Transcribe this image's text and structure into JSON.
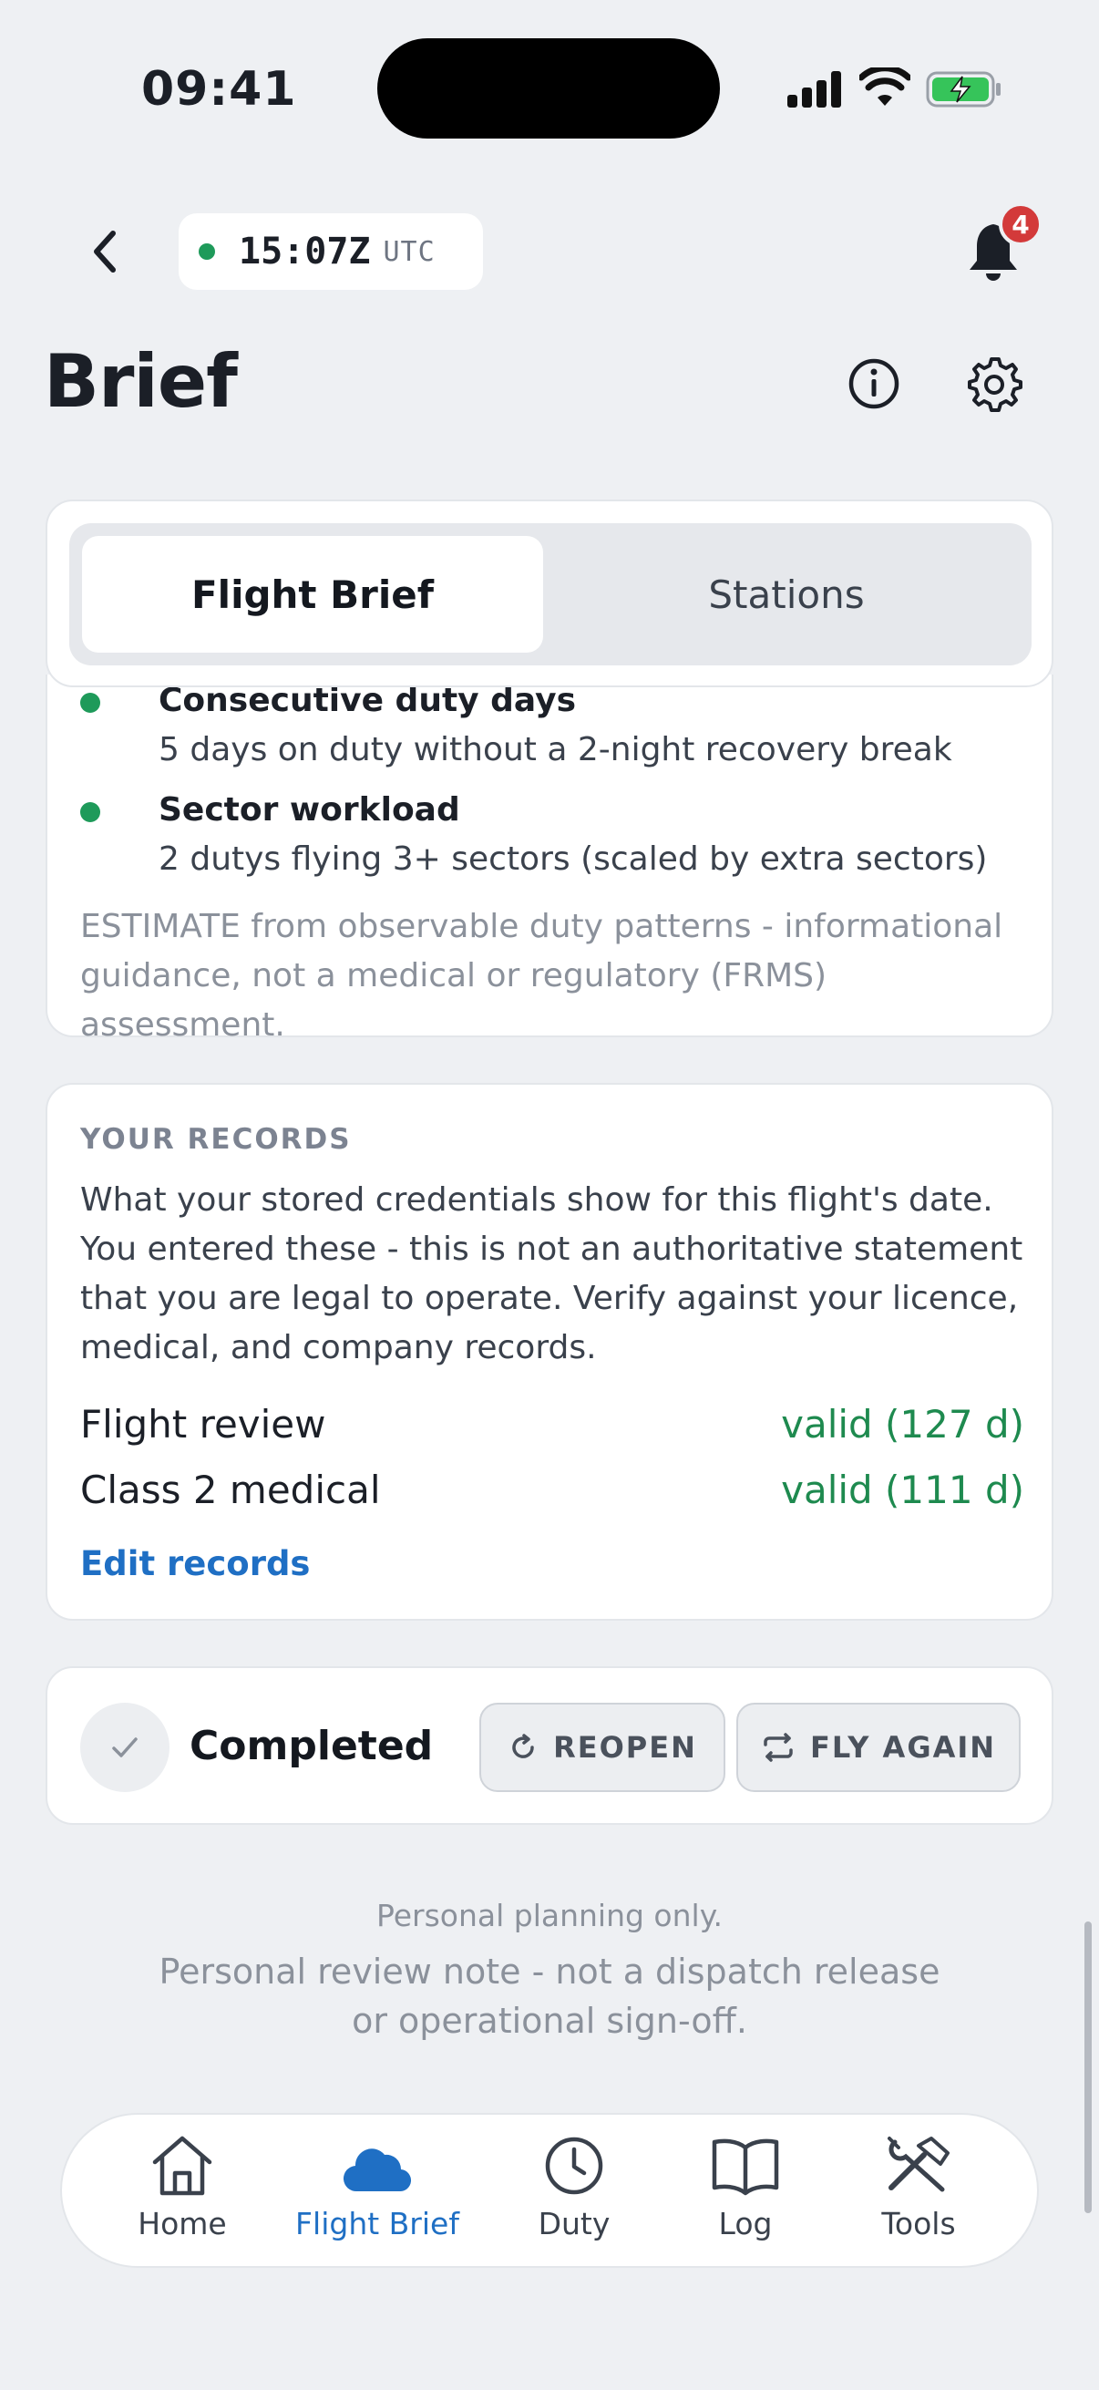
{
  "status_bar": {
    "time": "09:41"
  },
  "header": {
    "utc_time": "15:07Z",
    "utc_label": "UTC",
    "notification_count": "4",
    "title": "Brief"
  },
  "segmented": {
    "tabs": [
      {
        "label": "Flight Brief",
        "active": true
      },
      {
        "label": "Stations",
        "active": false
      }
    ]
  },
  "fatigue": {
    "items": [
      {
        "title": "Consecutive duty days",
        "desc": "5 days on duty without a 2-night recovery break"
      },
      {
        "title": "Sector workload",
        "desc": "2 dutys flying 3+ sectors (scaled by extra sectors)"
      }
    ],
    "note": "ESTIMATE from observable duty patterns - informational guidance, not a medical or regulatory (FRMS) assessment."
  },
  "records": {
    "heading": "YOUR RECORDS",
    "description": "What your stored credentials show for this flight's date. You entered these - this is not an authoritative statement that you are legal to operate. Verify against your licence, medical, and company records.",
    "rows": [
      {
        "label": "Flight review",
        "value": "valid (127 d)"
      },
      {
        "label": "Class 2 medical",
        "value": "valid (111 d)"
      }
    ],
    "edit_label": "Edit records"
  },
  "completion": {
    "status": "Completed",
    "reopen_label": "REOPEN",
    "fly_again_label": "FLY AGAIN"
  },
  "footer": {
    "small_note": "Personal planning only.",
    "large_note": "Personal review note - not a dispatch release or operational sign-off."
  },
  "tabbar": {
    "items": [
      {
        "label": "Home",
        "icon": "home-icon"
      },
      {
        "label": "Flight Brief",
        "icon": "cloud-icon",
        "active": true
      },
      {
        "label": "Duty",
        "icon": "clock-icon"
      },
      {
        "label": "Log",
        "icon": "book-icon"
      },
      {
        "label": "Tools",
        "icon": "tools-icon"
      }
    ]
  },
  "colors": {
    "accent": "#1f6fc4",
    "success": "#1e8a4f",
    "badge": "#d33a3a",
    "background": "#eef0f3"
  }
}
